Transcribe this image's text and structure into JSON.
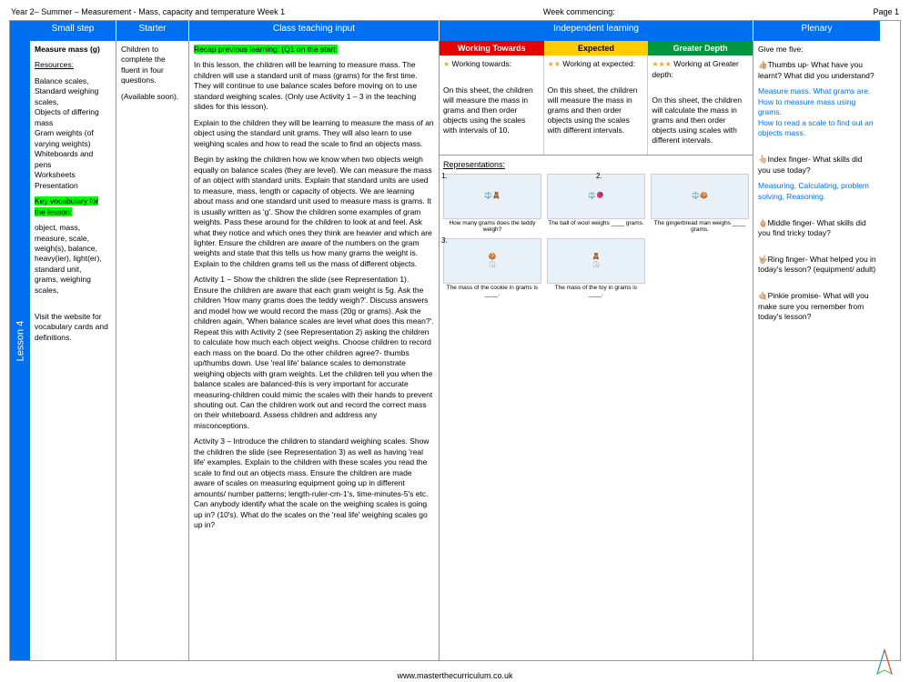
{
  "header": {
    "title": "Year 2– Summer – Measurement - Mass, capacity and temperature  Week 1",
    "week_commencing_label": "Week commencing:",
    "page_label": "Page 1"
  },
  "columns": {
    "small_step": "Small step",
    "starter": "Starter",
    "class_input": "Class teaching input",
    "independent": "Independent learning",
    "plenary": "Plenary"
  },
  "sidebar_label": "Lesson 4",
  "small_step": {
    "title": "Measure mass (g)",
    "resources_label": "Resources:",
    "resources": "Balance scales,\nStandard weighing scales,\nObjects of differing mass\nGram weights (of varying weights)\nWhiteboards and pens\nWorksheets\nPresentation",
    "vocab_label": "Key vocabulary for the lesson:",
    "vocab": "object, mass, measure, scale, weigh(s), balance, heavy(ier), light(er), standard unit,\ngrams, weighing scales,",
    "website": "Visit the website for vocabulary cards and definitions."
  },
  "starter": {
    "line1": "Children to complete the fluent in four questions.",
    "line2": "(Available soon)."
  },
  "class_input": {
    "recap": "Recap previous learning: (Q1 on the start:",
    "p1": "In this lesson, the children will be learning to measure mass. The children will use a standard unit of mass (grams) for the first time. They will continue to use balance scales before moving on to use standard weighing scales. (Only use Activity 1 – 3 in the teaching slides for this lesson).",
    "p2": "Explain to the children they will be learning to measure the mass of an object using the standard unit grams. They will also learn to use weighing scales and how to read the scale to find an objects mass.",
    "p3": "Begin by asking the children how we know when two objects weigh equally on balance scales (they are level). We can measure the mass of an object with standard units. Explain that standard units are used to measure, mass, length or capacity of objects. We are learning about mass and one standard unit used to measure mass is grams. It is usually written as 'g'. Show the children some examples of gram weights. Pass these around for the children to look at and feel. Ask what they notice and which ones they think are heavier and which are lighter. Ensure the children are aware of the numbers on the gram weights and state that this tells us how many grams the weight is. Explain to the children grams tell us the mass of different objects.",
    "p4": "Activity 1 – Show the children the slide (see Representation 1). Ensure the children are aware that each gram weight is 5g. Ask the children 'How many grams does the teddy weigh?'. Discuss answers and model how we would record the mass (20g or grams). Ask the children again, 'When balance scales are level what does this mean?'. Repeat this with Activity 2 (see Representation 2) asking the children to calculate how much each object weighs. Choose children to record each mass on the board. Do the other children agree?- thumbs up/thumbs down. Use 'real life' balance scales to demonstrate weighing objects with gram weights. Let the children tell you when the balance scales are balanced-this is very important for accurate measuring-children could mimic the scales with their hands to prevent shouting out. Can the children work out and record the correct mass on their whiteboard. Assess children and address any misconceptions.",
    "p5": "Activity 3 – Introduce the children to standard weighing scales. Show the children the slide (see Representation 3) as well as having 'real life' examples. Explain to the children with these scales you read the scale to find out an objects mass. Ensure the children are made aware of scales on measuring equipment going up in different amounts/ number patterns; length-ruler-cm-1's, time-minutes-5's etc. Can anybody identify what the scale on the weighing scales is going up in? (10's). What do the scales on the 'real life' weighing scales go up in?"
  },
  "independent": {
    "headers": {
      "wt": "Working Towards",
      "exp": "Expected",
      "gd": "Greater Depth"
    },
    "wt_sub": "Working towards:",
    "exp_sub": "Working at expected:",
    "gd_sub": "Working at Greater depth:",
    "wt_body": "On this sheet, the children will measure the mass in grams and then order objects using the scales with intervals of 10.",
    "exp_body": "On this sheet, the children will measure the mass in grams and then order objects using the scales with different intervals.",
    "gd_body": "On this sheet, the children will calculate the mass in grams and then order objects using scales with different intervals.",
    "reps_label": "Representations:",
    "caps": {
      "c1": "How many grams does the teddy weigh?",
      "c2a": "The ball of wool weighs ____ grams.",
      "c2b": "The gingerbread man weighs ____ grams.",
      "c3a": "The mass of the cookie in grams is ____.",
      "c3b": "The mass of the toy in grams is ____."
    }
  },
  "plenary": {
    "give": "Give me five:",
    "thumbs": "👍🏼Thumbs up- What have you learnt? What did you understand?",
    "thumbs_blue": "Measure mass. What grams are. How to measure mass using grams.\nHow to read a scale to find out an objects mass.",
    "index": "👆🏼Index finger- What skills did you use today?",
    "index_blue": "Measuring, Calculating, problem solving, Reasoning.",
    "middle": "🖕🏼Middle finger- What skills did you find tricky today?",
    "ring": "🤟🏼Ring finger- What helped you in today's lesson? (equipment/ adult)",
    "pinkie": "🤙🏼Pinkie promise- What will you make sure you remember from today's lesson?"
  },
  "footer_url": "www.masterthecurriculum.co.uk"
}
